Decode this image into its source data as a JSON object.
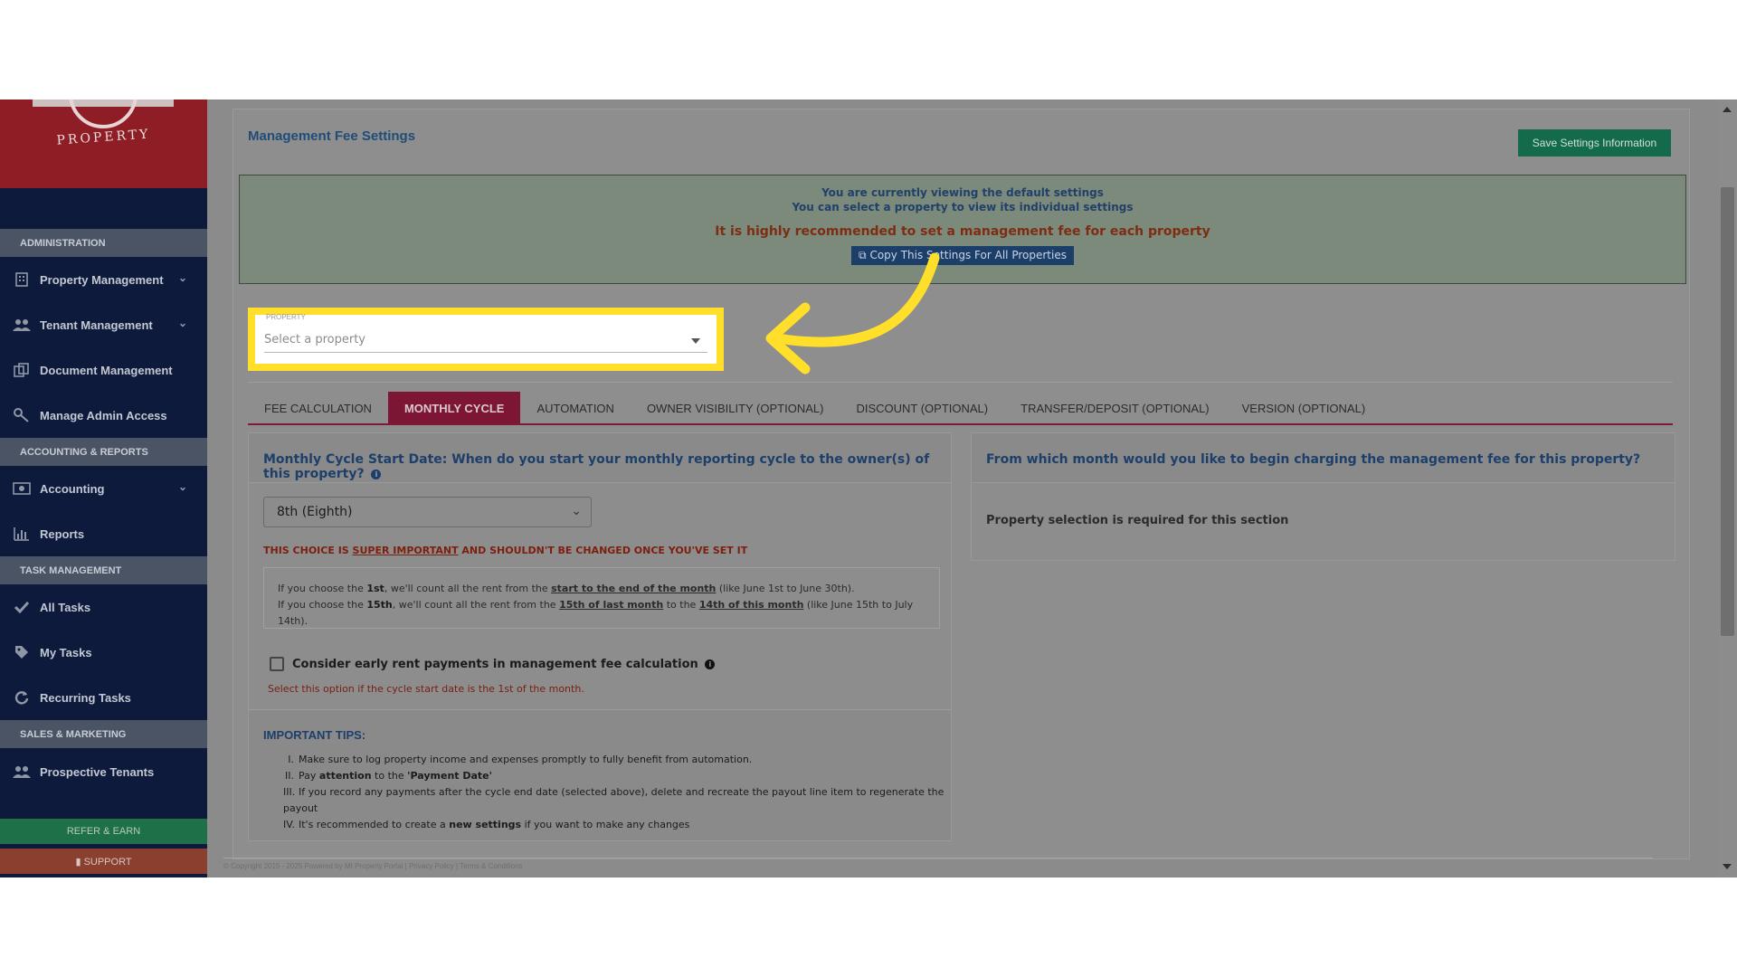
{
  "sidebar": {
    "logo_text": "PROPERTY",
    "sections": [
      {
        "title": "ADMINISTRATION"
      },
      {
        "title": "ACCOUNTING & REPORTS"
      },
      {
        "title": "TASK MANAGEMENT"
      },
      {
        "title": "SALES & MARKETING"
      }
    ],
    "items": [
      {
        "label": "Property Management",
        "icon": "building-icon"
      },
      {
        "label": "Tenant Management",
        "icon": "users-icon"
      },
      {
        "label": "Document Management",
        "icon": "documents-icon"
      },
      {
        "label": "Manage Admin Access",
        "icon": "key-icon"
      },
      {
        "label": "Accounting",
        "icon": "money-icon"
      },
      {
        "label": "Reports",
        "icon": "bar-chart-icon"
      },
      {
        "label": "All Tasks",
        "icon": "check-icon"
      },
      {
        "label": "My Tasks",
        "icon": "tag-icon"
      },
      {
        "label": "Recurring Tasks",
        "icon": "refresh-icon"
      },
      {
        "label": "Prospective Tenants",
        "icon": "users-icon"
      }
    ],
    "refer_label": "REFER & EARN",
    "support_label": "SUPPORT"
  },
  "header": {
    "title": "Management Fee Settings",
    "save_label": "Save Settings Information"
  },
  "notice": {
    "line1": "You are currently viewing the default settings",
    "line2": "You can select a property to view its individual settings",
    "line3": "It is highly recommended to set a management fee for each property",
    "copy_label": "Copy This Settings For All Properties"
  },
  "property_select": {
    "label": "PROPERTY",
    "placeholder": "Select a property"
  },
  "tabs": [
    {
      "label": "FEE CALCULATION"
    },
    {
      "label": "MONTHLY CYCLE"
    },
    {
      "label": "AUTOMATION"
    },
    {
      "label": "OWNER VISIBILITY (OPTIONAL)"
    },
    {
      "label": "DISCOUNT (OPTIONAL)"
    },
    {
      "label": "TRANSFER/DEPOSIT (OPTIONAL)"
    },
    {
      "label": "VERSION (OPTIONAL)"
    }
  ],
  "monthly_cycle": {
    "question": "Monthly Cycle Start Date: When do you start your monthly reporting cycle to the owner(s) of this property?",
    "selected": "8th (Eighth)",
    "warn_prefix": "THIS CHOICE IS ",
    "warn_emph": "SUPER IMPORTANT",
    "warn_suffix": " AND SHOULDN'T BE CHANGED ONCE YOU'VE SET IT",
    "explain1": {
      "a": "If you choose the ",
      "b": "1st",
      "c": ", we'll count all the rent from the ",
      "d": "start to the end of the month",
      "e": " (like June 1st to June 30th)."
    },
    "explain2": {
      "a": "If you choose the ",
      "b": "15th",
      "c": ", we'll count all the rent from the ",
      "d": "15th of last month",
      "e": " to the ",
      "f": "14th of this month",
      "g": " (like June 15th to July 14th)."
    },
    "checkbox_label": "Consider early rent payments in management fee calculation",
    "checkbox_help": "Select this option if the cycle start date is the 1st of the month.",
    "tips_title": "IMPORTANT TIPS:",
    "tips": [
      {
        "num": "I.",
        "a": "Make sure to log property income and expenses promptly to fully benefit from automation.",
        "b": "",
        "c": ""
      },
      {
        "num": "II.",
        "a": "Pay ",
        "b": "attention",
        "c": " to the ",
        "d": "'Payment Date'"
      },
      {
        "num": "III.",
        "a": "If you record any payments after the cycle end date (selected above), delete and recreate the payout line item to regenerate the payout"
      },
      {
        "num": "IV.",
        "a": "It's recommended to create a ",
        "b": "new settings",
        "c": " if you want to make any changes"
      }
    ]
  },
  "right_card": {
    "question": "From which month would you like to begin charging the management fee for this property?",
    "required_text": "Property selection is required for this section"
  },
  "footer": {
    "text": "© Copyright 2015 - 2025 Powered by MI Property Portal | Privacy Policy | Terms & Conditions"
  },
  "colors": {
    "sidebar_bg": "#0d1a3c",
    "accent_tab": "#7d1634",
    "save_button": "#146b4b",
    "highlight": "#ffdf2a"
  }
}
